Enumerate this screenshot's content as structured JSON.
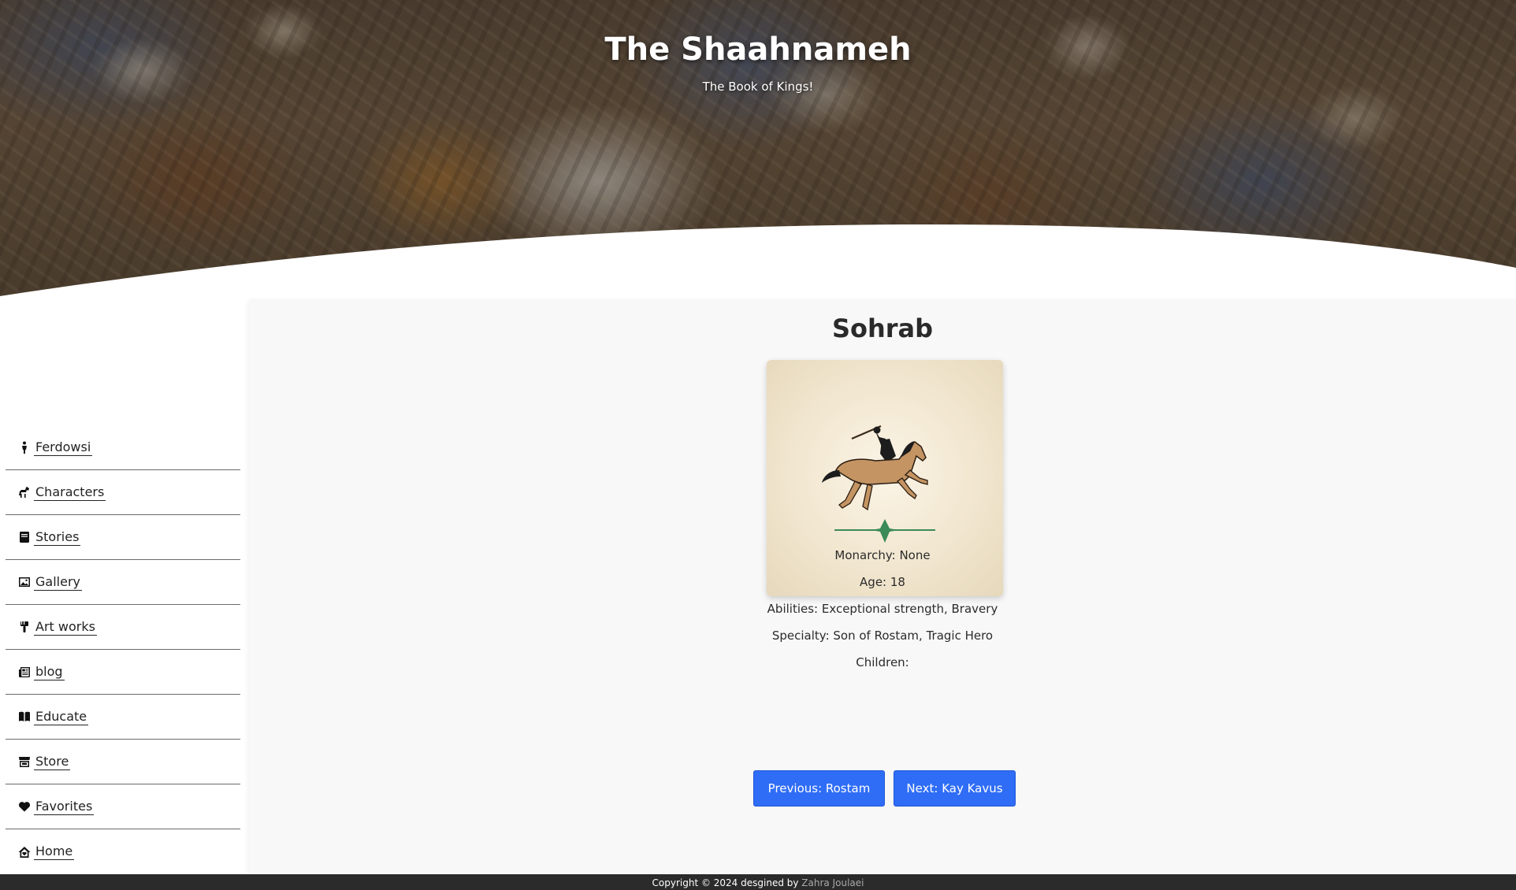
{
  "header": {
    "title": "The Shaahnameh",
    "subtitle": "The Book of Kings!"
  },
  "sidebar": {
    "items": [
      {
        "label": "Ferdowsi",
        "icon": "person-icon"
      },
      {
        "label": "Characters",
        "icon": "horse-icon"
      },
      {
        "label": "Stories",
        "icon": "book-icon"
      },
      {
        "label": "Gallery",
        "icon": "image-icon"
      },
      {
        "label": "Art works",
        "icon": "paintbrush-icon"
      },
      {
        "label": "blog",
        "icon": "newspaper-icon"
      },
      {
        "label": "Educate",
        "icon": "open-book-icon"
      },
      {
        "label": "Store",
        "icon": "store-icon"
      },
      {
        "label": "Favorites",
        "icon": "heart-icon"
      },
      {
        "label": "Home",
        "icon": "home-icon"
      }
    ]
  },
  "character": {
    "name": "Sohrab",
    "monarchy": "Monarchy: None",
    "age": "Age: 18",
    "abilities": "Abilities: Exceptional strength, Bravery",
    "specialty": "Specialty: Son of Rostam, Tragic Hero",
    "children": "Children:"
  },
  "navigation": {
    "previous_label": "Previous: Rostam",
    "next_label": "Next: Kay Kavus"
  },
  "footer": {
    "text": "Copyright © 2024 desgined by",
    "author": "Zahra Joulaei"
  },
  "colors": {
    "accent": "#2f6df6",
    "footer_bg": "#2b2b2b",
    "main_bg": "#f8f8f8"
  }
}
